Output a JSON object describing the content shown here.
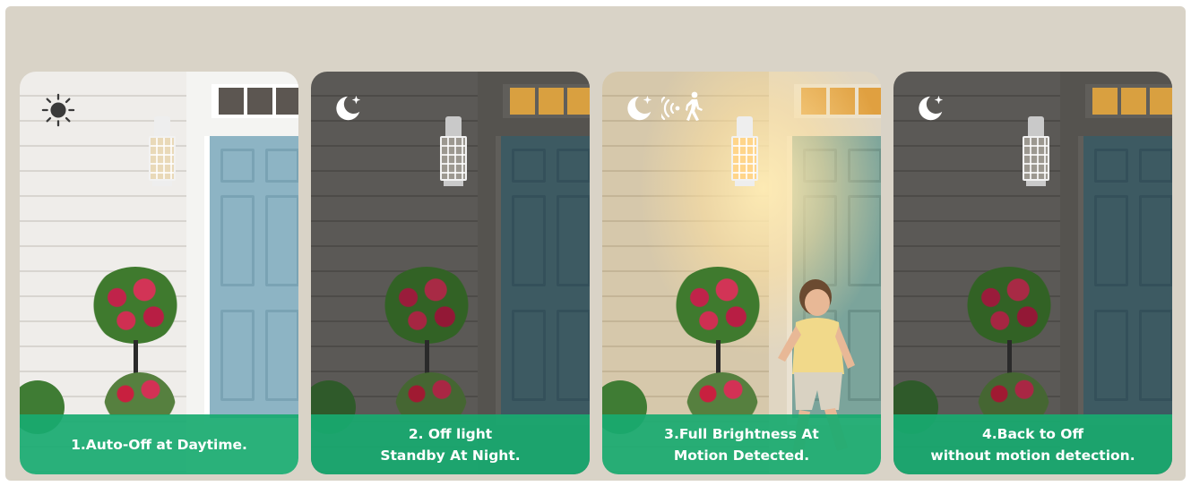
{
  "panels": [
    {
      "caption_lines": [
        "1.Auto-Off at Daytime."
      ],
      "mode_icons": [
        "sun-icon"
      ],
      "colors": {
        "siding": "#eceae6",
        "door": "#8ab2c2",
        "glass": "#5b5550"
      }
    },
    {
      "caption_lines": [
        "2. Off light",
        "Standby At Night."
      ],
      "mode_icons": [
        "moon-icon"
      ],
      "colors": {
        "siding": "#5a5855",
        "door": "#3e5a62",
        "glass": "#d9a040"
      }
    },
    {
      "caption_lines": [
        "3.Full Brightness At",
        "Motion Detected."
      ],
      "mode_icons": [
        "moon-icon",
        "motion-sensor-icon",
        "person-walking-icon"
      ],
      "colors": {
        "siding": "#d8cbb0",
        "door": "#7aa39a",
        "glass": "#e0a040"
      }
    },
    {
      "caption_lines": [
        "4.Back to Off",
        "without motion detection."
      ],
      "mode_icons": [
        "moon-icon"
      ],
      "colors": {
        "siding": "#5a5855",
        "door": "#3e5a62",
        "glass": "#d9a040"
      }
    }
  ],
  "colors": {
    "background": "#d9d3c7",
    "caption_bar": "#18aa70",
    "caption_text": "#ffffff"
  }
}
